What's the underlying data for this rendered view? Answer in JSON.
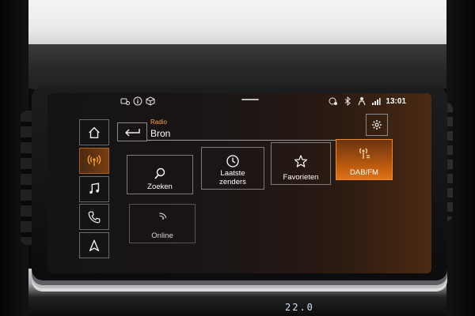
{
  "status": {
    "time": "13:01",
    "left_icons": [
      "phone-connection-icon",
      "info-icon",
      "cube-icon"
    ],
    "right_icons": [
      "mobile-signal-icon",
      "bluetooth-icon",
      "person-signal-icon",
      "signal-bars-icon"
    ]
  },
  "sidebar": {
    "items": [
      {
        "name": "home",
        "icon": "home-icon",
        "active": false
      },
      {
        "name": "radio",
        "icon": "radio-wave-icon",
        "active": true
      },
      {
        "name": "media",
        "icon": "music-note-icon",
        "active": false
      },
      {
        "name": "phone",
        "icon": "phone-icon",
        "active": false
      },
      {
        "name": "navigation",
        "icon": "navigation-arrow-icon",
        "active": false
      }
    ]
  },
  "header": {
    "breadcrumb": "Radio",
    "title": "Bron",
    "back_icon": "back-arrow-icon",
    "settings_icon": "gear-icon"
  },
  "tiles": [
    {
      "id": "zoeken",
      "label_line1": "Zoeken",
      "label_line2": "",
      "icon": "search-icon",
      "active": false
    },
    {
      "id": "laatste",
      "label_line1": "Laatste",
      "label_line2": "zenders",
      "icon": "history-icon",
      "active": false
    },
    {
      "id": "favorieten",
      "label_line1": "Favorieten",
      "label_line2": "",
      "icon": "star-icon",
      "active": false
    },
    {
      "id": "dab",
      "label_line1": "DAB/FM",
      "label_line2": "",
      "icon": "radio-antenna-icon",
      "active": true
    },
    {
      "id": "online",
      "label_line1": "Online",
      "label_line2": "",
      "icon": "wifi-icon",
      "active": false
    }
  ],
  "climate": {
    "temperature": "22.0"
  },
  "colors": {
    "accent": "#ffa53a",
    "active_tile": "#e0741a"
  }
}
